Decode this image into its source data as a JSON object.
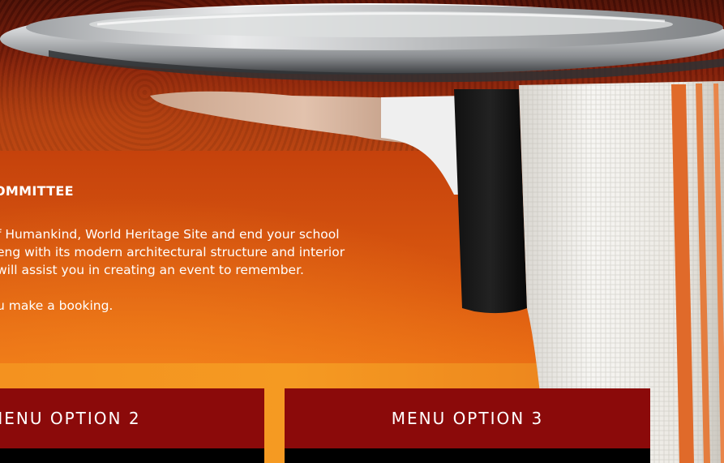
{
  "content": {
    "heading": "OMMITTEE",
    "paragraph_lines": [
      "f Humankind, World Heritage Site and end your school",
      "eng with its modern architectural structure and interior",
      "will assist you in creating an event to remember."
    ],
    "booking_line": "u make a booking."
  },
  "menu_options": [
    {
      "label": "MENU OPTION 2"
    },
    {
      "label": "MENU OPTION 3"
    }
  ],
  "colors": {
    "menu_card": "#8b0a0a",
    "panel_orange": "#e8640f",
    "towel_stripe": "#e06a2a"
  },
  "icons": [
    "silver-tray-illustration",
    "waiter-hand-illustration",
    "white-towel-illustration"
  ]
}
